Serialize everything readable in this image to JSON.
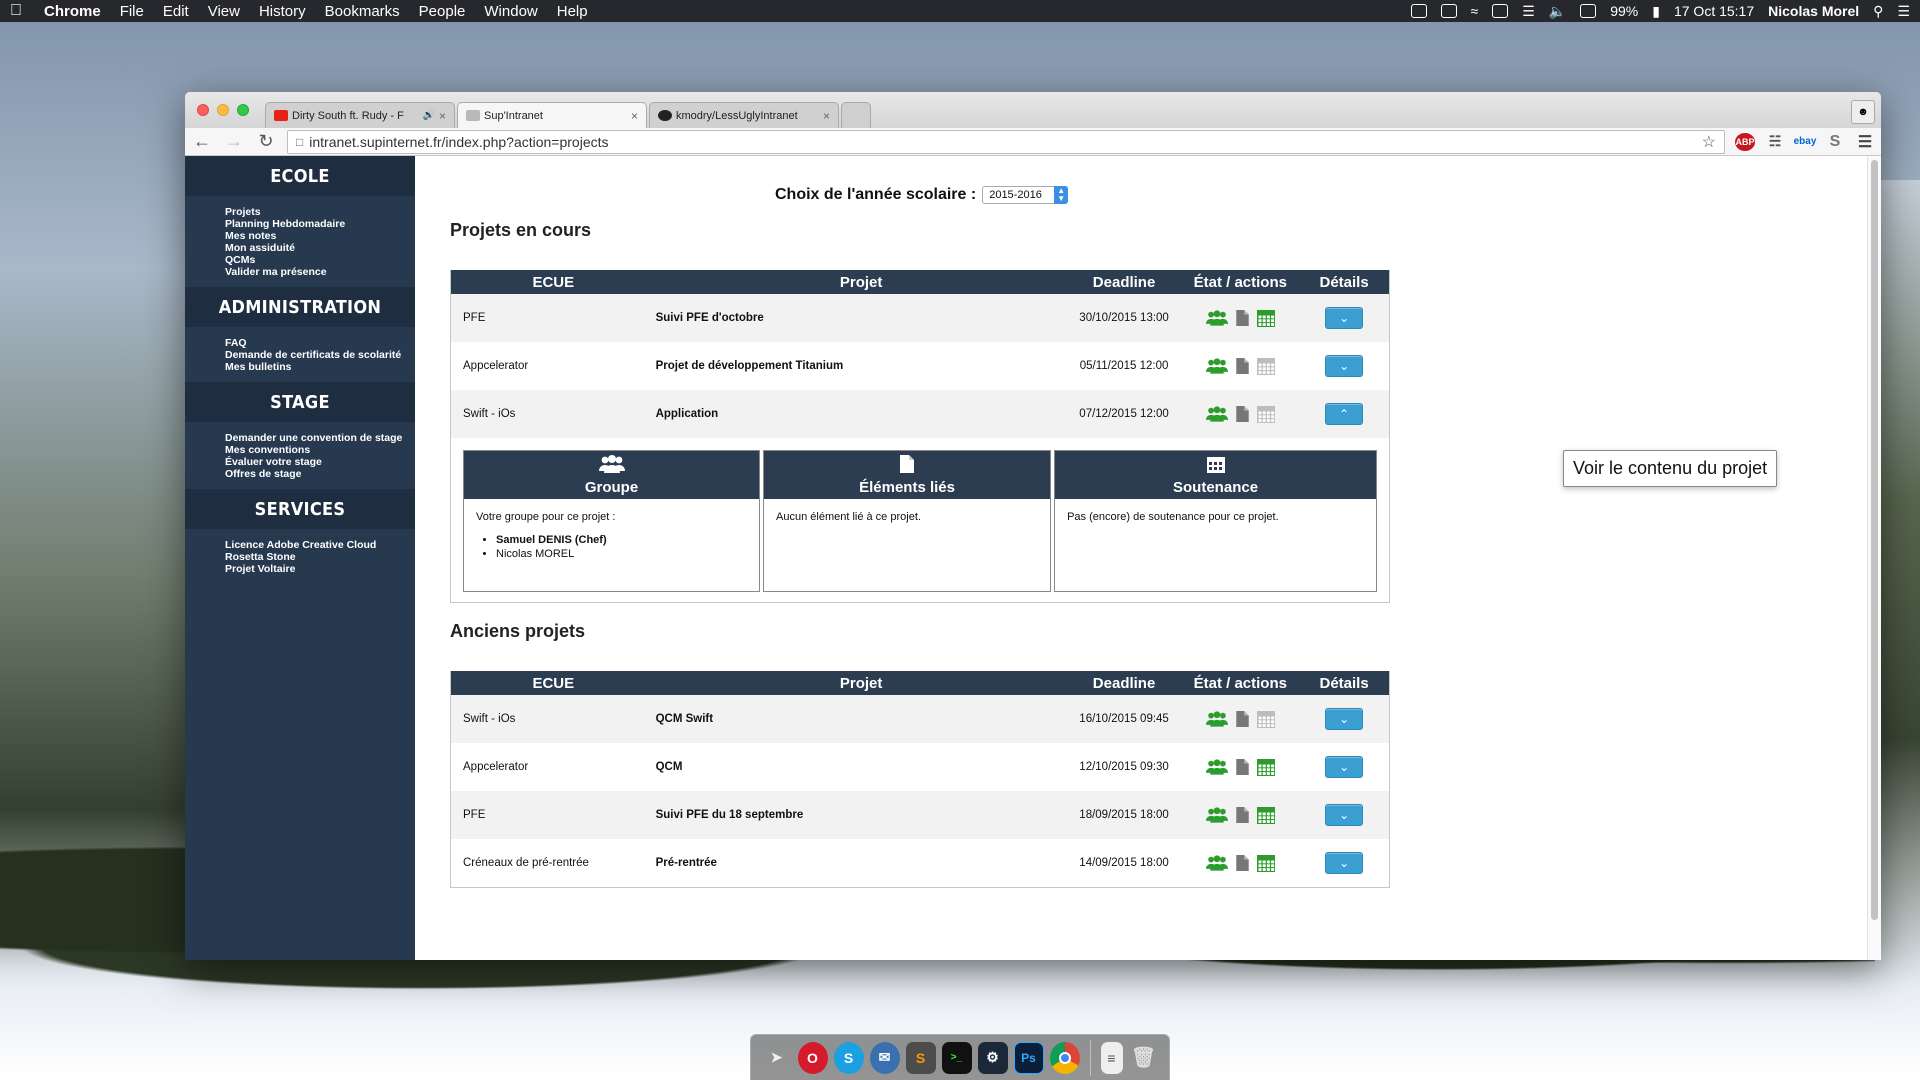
{
  "menubar": {
    "app": "Chrome",
    "items": [
      "File",
      "Edit",
      "View",
      "History",
      "Bookmarks",
      "People",
      "Window",
      "Help"
    ],
    "battery": "99%",
    "datetime": "17 Oct  15:17",
    "user": "Nicolas Morel"
  },
  "browser": {
    "tabs": [
      {
        "label": "Dirty South ft. Rudy - F",
        "favicon": "youtube-icon",
        "color": "#e62117"
      },
      {
        "label": "Sup'Intranet",
        "favicon": "supinternet-icon",
        "color": "#b9b9b9"
      },
      {
        "label": "kmodry/LessUglyIntranet",
        "favicon": "github-icon",
        "color": "#222222"
      }
    ],
    "url": "intranet.supinternet.fr/index.php?action=projects",
    "extensions": [
      "ABP",
      "ebay",
      "S"
    ]
  },
  "sidebar": {
    "sections": [
      {
        "title": "ECOLE",
        "items": [
          "Projets",
          "Planning Hebdomadaire",
          "Mes notes",
          "Mon assiduité",
          "QCMs",
          "Valider ma présence"
        ]
      },
      {
        "title": "ADMINISTRATION",
        "items": [
          "FAQ",
          "Demande de certificats de scolarité",
          "Mes bulletins"
        ]
      },
      {
        "title": "STAGE",
        "items": [
          "Demander une convention de stage",
          "Mes conventions",
          "Évaluer votre stage",
          "Offres de stage"
        ]
      },
      {
        "title": "SERVICES",
        "items": [
          "Licence Adobe Creative Cloud",
          "Rosetta Stone",
          "Projet Voltaire"
        ]
      }
    ]
  },
  "year": {
    "label": "Choix de l'année scolaire :",
    "value": "2015-2016"
  },
  "current": {
    "title": "Projets en cours",
    "headers": {
      "ecue": "ECUE",
      "project": "Projet",
      "deadline": "Deadline",
      "state": "État / actions",
      "details": "Détails"
    },
    "rows": [
      {
        "ecue": "PFE",
        "project": "Suivi PFE d'octobre",
        "deadline": "30/10/2015 13:00",
        "calendar_active": true,
        "expanded": false
      },
      {
        "ecue": "Appcelerator",
        "project": "Projet de développement Titanium",
        "deadline": "05/11/2015 12:00",
        "calendar_active": false,
        "expanded": false
      },
      {
        "ecue": "Swift - iOs",
        "project": "Application",
        "deadline": "07/12/2015 12:00",
        "calendar_active": false,
        "expanded": true
      }
    ],
    "details": {
      "group": {
        "title": "Groupe",
        "intro": "Votre groupe pour ce projet :",
        "members": [
          "Samuel DENIS (Chef)",
          "Nicolas MOREL"
        ]
      },
      "linked": {
        "title": "Éléments liés",
        "text": "Aucun élément lié à ce projet."
      },
      "defense": {
        "title": "Soutenance",
        "text": "Pas (encore) de soutenance pour ce projet."
      }
    }
  },
  "tooltip": "Voir le contenu du projet",
  "old": {
    "title": "Anciens projets",
    "headers": {
      "ecue": "ECUE",
      "project": "Projet",
      "deadline": "Deadline",
      "state": "État / actions",
      "details": "Détails"
    },
    "rows": [
      {
        "ecue": "Swift - iOs",
        "project": "QCM Swift",
        "deadline": "16/10/2015 09:45",
        "calendar_active": false
      },
      {
        "ecue": "Appcelerator",
        "project": "QCM",
        "deadline": "12/10/2015 09:30",
        "calendar_active": true
      },
      {
        "ecue": "PFE",
        "project": "Suivi PFE du 18 septembre",
        "deadline": "18/09/2015 18:00",
        "calendar_active": true
      },
      {
        "ecue": "Créneaux de pré-rentrée",
        "project": "Pré-rentrée",
        "deadline": "14/09/2015 18:00",
        "calendar_active": true
      }
    ]
  },
  "colors": {
    "sidebar": "#27394f",
    "header": "#2c3d52",
    "green": "#2c9c2c",
    "button": "#3b9fd1"
  },
  "dock": [
    "send-icon",
    "opera-icon",
    "skype-icon",
    "thunderbird-icon",
    "sublime-icon",
    "terminal-icon",
    "steam-icon",
    "photoshop-icon",
    "chrome-icon",
    "document-icon",
    "trash-icon"
  ]
}
